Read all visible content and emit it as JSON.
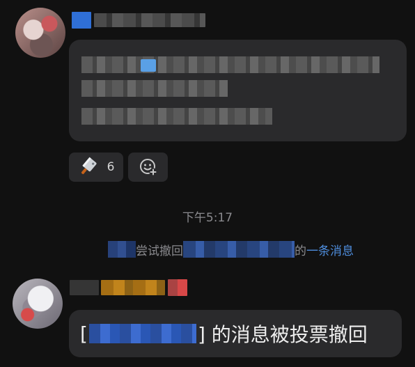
{
  "messages": [
    {
      "id": "msg-1",
      "reactions": [
        {
          "icon": "cleaver-emoji-icon",
          "count": "6"
        },
        {
          "icon": "add-reaction-icon"
        }
      ]
    }
  ],
  "timestamp": "下午5:17",
  "system_notice": {
    "middle_text": "尝试撤回",
    "suffix_text": "的",
    "link_text": "一条消息"
  },
  "vote_message": {
    "open_bracket": "[",
    "close_text": "] 的消息被投票撤回"
  },
  "colors": {
    "background": "#111111",
    "bubble": "#2a2a2c",
    "muted_text": "#8a8a8e",
    "link": "#4e8ddd"
  }
}
